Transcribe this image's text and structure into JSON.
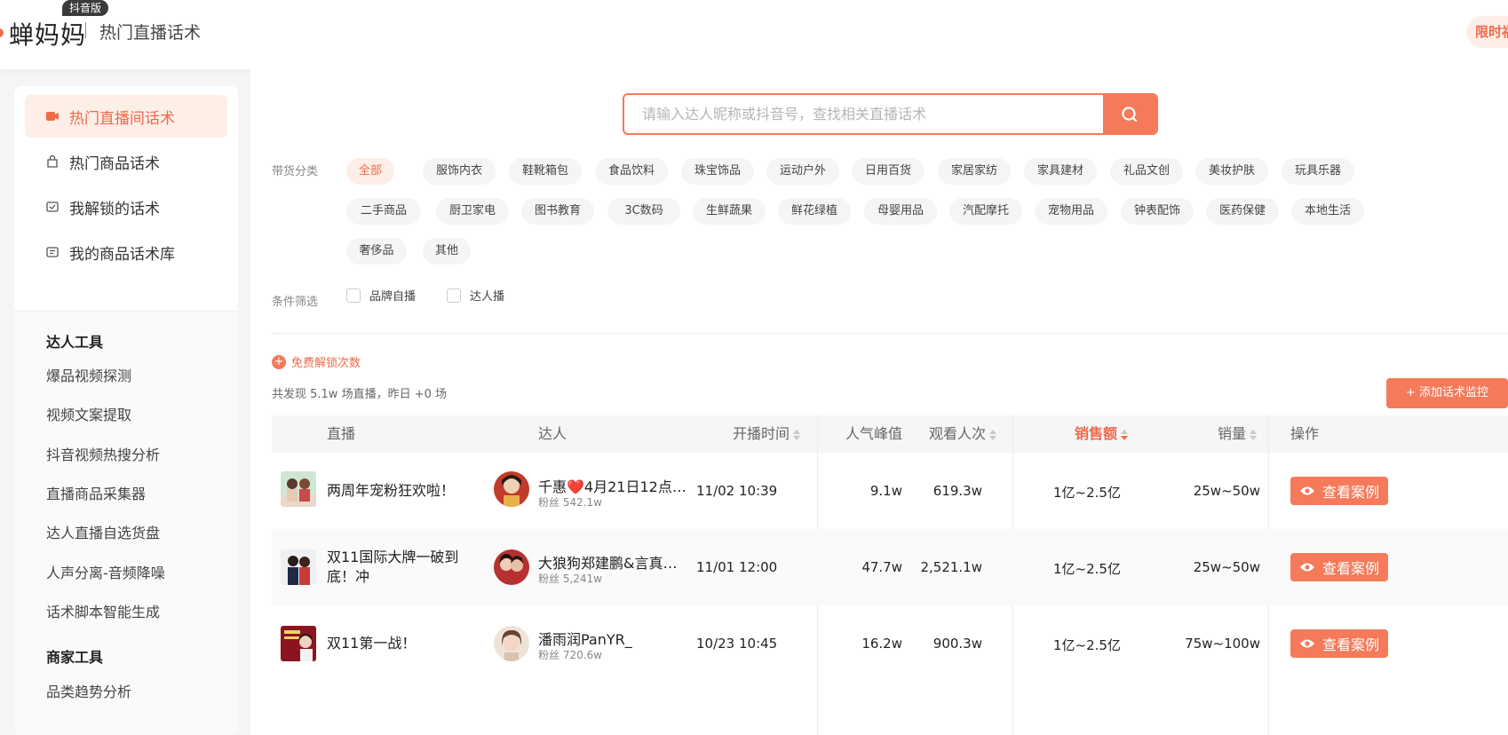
{
  "header": {
    "logo_text": "蝉妈妈",
    "logo_badge": "抖音版",
    "title": "热门直播话术",
    "promo": "限时福利"
  },
  "colors": {
    "accent": "#f47a5a",
    "accent_text": "#f06a4a",
    "accent_bg": "#fdeee8"
  },
  "sidebar": {
    "menu": [
      {
        "label": "热门直播间话术",
        "icon": "live-icon",
        "active": true
      },
      {
        "label": "热门商品话术",
        "icon": "bag-icon",
        "active": false
      },
      {
        "label": "我解锁的话术",
        "icon": "unlock-icon",
        "active": false
      },
      {
        "label": "我的商品话术库",
        "icon": "library-icon",
        "active": false
      }
    ],
    "section1": "达人工具",
    "tools": [
      "爆品视频探测",
      "视频文案提取",
      "抖音视频热搜分析",
      "直播商品采集器",
      "达人直播自选货盘",
      "人声分离-音频降噪",
      "话术脚本智能生成"
    ],
    "section2": "商家工具",
    "merchant_tools": [
      "品类趋势分析"
    ]
  },
  "search": {
    "placeholder": "请输入达人昵称或抖音号，查找相关直播话术",
    "icon": "search-icon"
  },
  "filters": {
    "category_label": "带货分类",
    "categories": [
      "全部",
      "服饰内衣",
      "鞋靴箱包",
      "食品饮料",
      "珠宝饰品",
      "运动户外",
      "日用百货",
      "家居家纺",
      "家具建材",
      "礼品文创",
      "美妆护肤",
      "玩具乐器",
      "二手商品",
      "厨卫家电",
      "图书教育",
      "3C数码",
      "生鲜蔬果",
      "鲜花绿植",
      "母婴用品",
      "汽配摩托",
      "宠物用品",
      "钟表配饰",
      "医药保健",
      "本地生活",
      "奢侈品",
      "其他"
    ],
    "selected_category": "全部",
    "condition_label": "条件筛选",
    "conditions": [
      {
        "label": "品牌自播",
        "checked": false
      },
      {
        "label": "达人播",
        "checked": false
      }
    ]
  },
  "free_unlock": "免费解锁次数",
  "summary": "共发现 5.1w 场直播，昨日 +0 场",
  "add_monitor": "+ 添加话术监控",
  "table": {
    "headers": {
      "live": "直播",
      "kol": "达人",
      "start_time": "开播时间",
      "peak": "人气峰值",
      "views": "观看人次",
      "sales_amount": "销售额",
      "sales_volume": "销量",
      "action": "操作"
    },
    "rows": [
      {
        "title": "两周年宠粉狂欢啦！",
        "kol_name": "千惠❤️4月21日12点…",
        "fans": "粉丝 542.1w",
        "start_time": "11/02 10:39",
        "peak": "9.1w",
        "views": "619.3w",
        "sales_amount": "1亿~2.5亿",
        "sales_volume": "25w~50w",
        "action": "查看案例"
      },
      {
        "title": "双11国际大牌一破到底！冲",
        "kol_name": "大狼狗郑建鹏&言真…",
        "fans": "粉丝 5,241w",
        "start_time": "11/01 12:00",
        "peak": "47.7w",
        "views": "2,521.1w",
        "sales_amount": "1亿~2.5亿",
        "sales_volume": "25w~50w",
        "action": "查看案例"
      },
      {
        "title": "双11第一战！",
        "kol_name": "潘雨润PanYR_",
        "fans": "粉丝 720.6w",
        "start_time": "10/23 10:45",
        "peak": "16.2w",
        "views": "900.3w",
        "sales_amount": "1亿~2.5亿",
        "sales_volume": "75w~100w",
        "action": "查看案例"
      }
    ]
  }
}
